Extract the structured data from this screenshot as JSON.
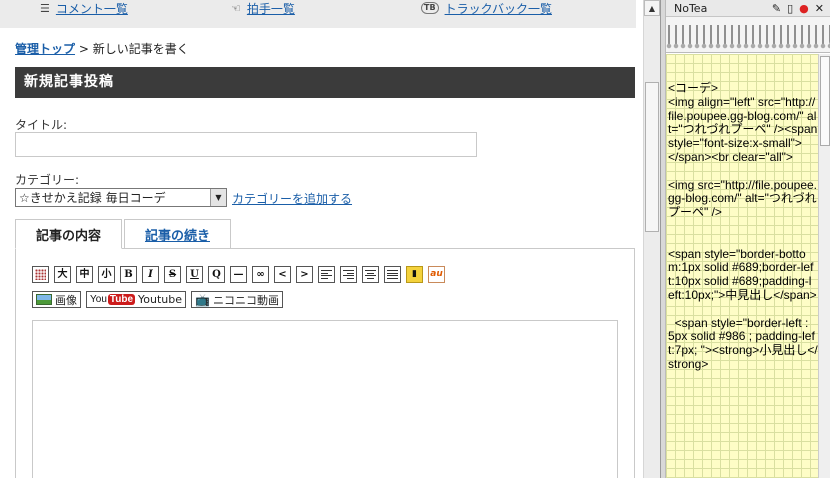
{
  "topnav": {
    "comments": "コメント一覧",
    "claps": "拍手一覧",
    "trackbacks": "トラックバック一覧",
    "trackback_icon": "TB"
  },
  "breadcrumb": {
    "home": "管理トップ",
    "separator": " > ",
    "current": "新しい記事を書く"
  },
  "section_title": "新規記事投稿",
  "title_field": {
    "label": "タイトル:",
    "value": ""
  },
  "category": {
    "label": "カテゴリー:",
    "selected": "☆きせかえ記録  毎日コーデ",
    "add_link": "カテゴリーを追加する"
  },
  "tabs": [
    {
      "label": "記事の内容"
    },
    {
      "label": "記事の続き"
    }
  ],
  "toolbar": {
    "big": "大",
    "medium": "中",
    "small": "小",
    "bold": "B",
    "italic": "I",
    "strike": "S",
    "underline": "U",
    "quote": "Q",
    "hr": "—",
    "link": "∞",
    "lt": "<",
    "gt": ">",
    "au": "au"
  },
  "media": {
    "image": "画像",
    "youtube_logo_a": "You",
    "youtube_logo_b": "Tube",
    "youtube": "Youtube",
    "nico": "ニコニコ動画"
  },
  "notea": {
    "title": "NoTea",
    "content": "<コーデ>\n<img align=\"left\" src=\"http://file.poupee.gg-blog.com/\" alt=\"つれづれプーペ\" /><span style=\"font-size:x-small\">\n</span><br clear=\"all\">\n\n<img src=\"http://file.poupee.gg-blog.com/\" alt=\"つれづれプーペ\" />\n\n\n<span style=\"border-bottom:1px solid #689;border-left:10px solid #689;padding-left:10px;\">中見出し</span>\n\n  <span style=\"border-left : 5px solid #986 ; padding-left:7px; \"><strong>小見出し</strong>"
  },
  "colors": {
    "section_bar": "#3b3b3b",
    "link": "#1a5ea8",
    "notepad": "#fefdc6"
  }
}
